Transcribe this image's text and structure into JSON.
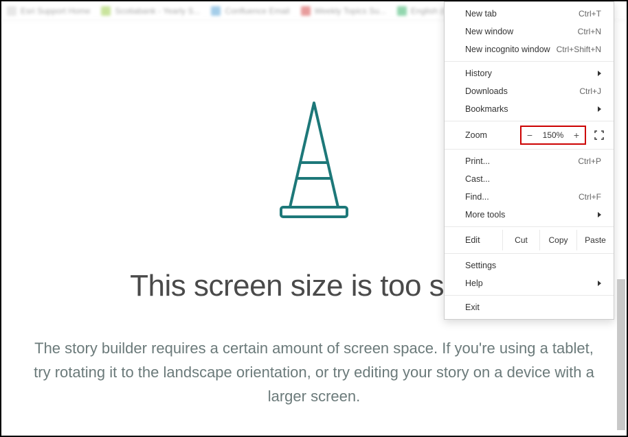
{
  "bookmarks": [
    {
      "label": "Esri Support Home",
      "color": "#d0d0d0"
    },
    {
      "label": "Scotiabank - Yearly S...",
      "color": "#95c93d"
    },
    {
      "label": "Confluence Email",
      "color": "#4b9cd3"
    },
    {
      "label": "Weekly Topics Su...",
      "color": "#d13b3b"
    },
    {
      "label": "English (Ca...",
      "color": "#27ae60"
    }
  ],
  "menu": {
    "new_tab": {
      "label": "New tab",
      "shortcut": "Ctrl+T"
    },
    "new_window": {
      "label": "New window",
      "shortcut": "Ctrl+N"
    },
    "new_incognito": {
      "label": "New incognito window",
      "shortcut": "Ctrl+Shift+N"
    },
    "history": {
      "label": "History"
    },
    "downloads": {
      "label": "Downloads",
      "shortcut": "Ctrl+J"
    },
    "bookmarks": {
      "label": "Bookmarks"
    },
    "zoom": {
      "label": "Zoom",
      "value": "150%",
      "minus": "−",
      "plus": "+"
    },
    "print": {
      "label": "Print...",
      "shortcut": "Ctrl+P"
    },
    "cast": {
      "label": "Cast..."
    },
    "find": {
      "label": "Find...",
      "shortcut": "Ctrl+F"
    },
    "more_tools": {
      "label": "More tools"
    },
    "edit": {
      "label": "Edit",
      "cut": "Cut",
      "copy": "Copy",
      "paste": "Paste"
    },
    "settings": {
      "label": "Settings"
    },
    "help": {
      "label": "Help"
    },
    "exit": {
      "label": "Exit"
    }
  },
  "page": {
    "heading": "This screen size is too small",
    "body": "The story builder requires a certain amount of screen space. If you're using a tablet, try rotating it to the landscape orientation, or try editing your story on a device with a larger screen."
  }
}
